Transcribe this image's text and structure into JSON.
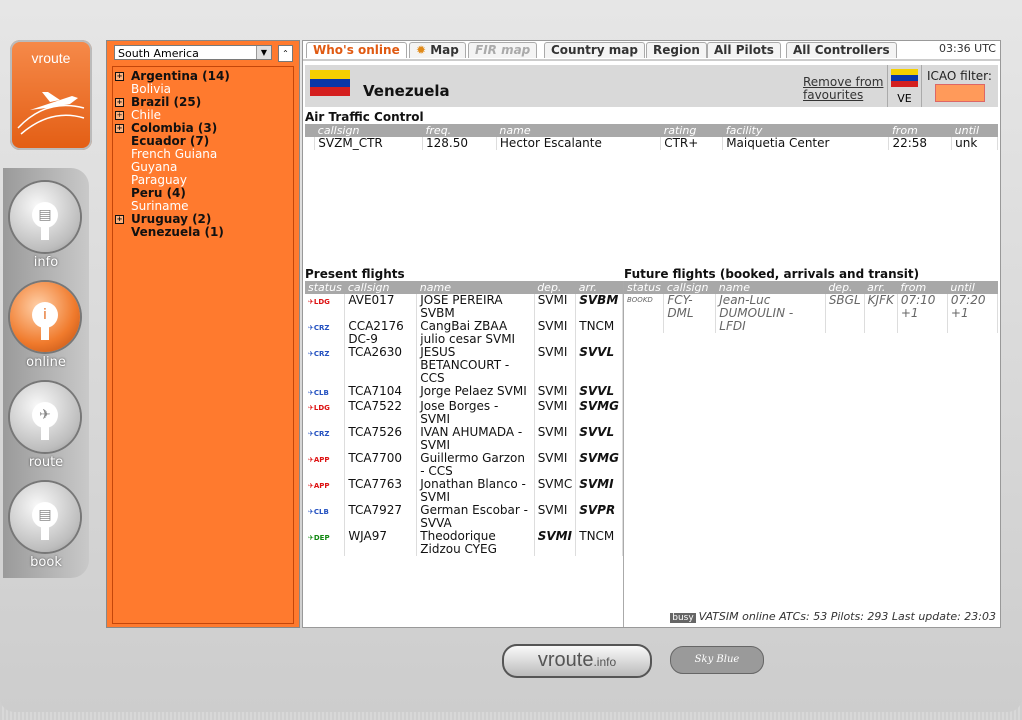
{
  "app": {
    "logo_text": "vroute",
    "bottom_logo": "vroute",
    "bottom_logo_suffix": ".info",
    "partner_logo": "Sky Blue"
  },
  "nav": [
    {
      "label": "info",
      "icon": "document-icon"
    },
    {
      "label": "online",
      "icon": "info-icon",
      "active": true
    },
    {
      "label": "route",
      "icon": "plane-icon"
    },
    {
      "label": "book",
      "icon": "document-icon"
    }
  ],
  "tree": {
    "region": "South America",
    "items": [
      {
        "label": "Argentina (14)",
        "bold": true,
        "expand": true
      },
      {
        "label": "Bolivia",
        "bold": false,
        "expand": false
      },
      {
        "label": "Brazil (25)",
        "bold": true,
        "expand": true
      },
      {
        "label": "Chile",
        "bold": false,
        "expand": true
      },
      {
        "label": "Colombia (3)",
        "bold": true,
        "expand": true
      },
      {
        "label": "Ecuador (7)",
        "bold": true,
        "expand": false
      },
      {
        "label": "French Guiana",
        "bold": false,
        "expand": false
      },
      {
        "label": "Guyana",
        "bold": false,
        "expand": false
      },
      {
        "label": "Paraguay",
        "bold": false,
        "expand": false
      },
      {
        "label": "Peru (4)",
        "bold": true,
        "expand": false
      },
      {
        "label": "Suriname",
        "bold": false,
        "expand": false
      },
      {
        "label": "Uruguay (2)",
        "bold": true,
        "expand": true
      },
      {
        "label": "Venezuela (1)",
        "bold": true,
        "expand": false
      }
    ]
  },
  "tabs": [
    {
      "label": "Who's online",
      "state": "active"
    },
    {
      "label": "Map",
      "state": "normal"
    },
    {
      "label": "FIR map",
      "state": "disabled"
    },
    {
      "label": "Country map",
      "state": "normal"
    },
    {
      "label": "Region",
      "state": "normal"
    },
    {
      "label": "All Pilots",
      "state": "normal"
    },
    {
      "label": "All Controllers",
      "state": "normal"
    }
  ],
  "clock": "03:36 UTC",
  "country": {
    "name": "Venezuela",
    "remove_fav": "Remove from favourites",
    "code": "VE",
    "icao_filter_label": "ICAO filter:",
    "icao_filter_value": ""
  },
  "atc": {
    "title": "Air Traffic Control",
    "headers": [
      "",
      "callsign",
      "freq.",
      "name",
      "rating",
      "facility",
      "from",
      "until"
    ],
    "rows": [
      [
        "",
        "SVZM_CTR",
        "128.50",
        "Hector Escalante",
        "CTR+",
        "Maiquetia Center",
        "22:58",
        "unk"
      ]
    ]
  },
  "present": {
    "title": "Present flights",
    "headers": [
      "status",
      "callsign",
      "name",
      "dep.",
      "arr."
    ],
    "rows": [
      {
        "status": "LDG",
        "callsign": "AVE017",
        "name": "JOSE PEREIRA SVBM",
        "dep": "SVMI",
        "arr": "SVBM",
        "dep_bold": false,
        "arr_bold": true
      },
      {
        "status": "CRZ",
        "callsign": "CCA2176 DC-9",
        "name": "CangBai ZBAA julio cesar SVMI",
        "dep": "SVMI",
        "arr": "TNCM",
        "dep_bold": false,
        "arr_bold": false
      },
      {
        "status": "CRZ",
        "callsign": "TCA2630",
        "name": "JESUS BETANCOURT - CCS",
        "dep": "SVMI",
        "arr": "SVVL",
        "dep_bold": false,
        "arr_bold": true
      },
      {
        "status": "CLB",
        "callsign": "TCA7104",
        "name": "Jorge Pelaez SVMI",
        "dep": "SVMI",
        "arr": "SVVL",
        "dep_bold": false,
        "arr_bold": true
      },
      {
        "status": "LDG",
        "callsign": "TCA7522",
        "name": "Jose Borges - SVMI",
        "dep": "SVMI",
        "arr": "SVMG",
        "dep_bold": false,
        "arr_bold": true
      },
      {
        "status": "CRZ",
        "callsign": "TCA7526",
        "name": "IVAN AHUMADA - SVMI",
        "dep": "SVMI",
        "arr": "SVVL",
        "dep_bold": false,
        "arr_bold": true
      },
      {
        "status": "APP",
        "callsign": "TCA7700",
        "name": "Guillermo Garzon - CCS",
        "dep": "SVMI",
        "arr": "SVMG",
        "dep_bold": false,
        "arr_bold": true
      },
      {
        "status": "APP",
        "callsign": "TCA7763",
        "name": "Jonathan Blanco - SVMI",
        "dep": "SVMC",
        "arr": "SVMI",
        "dep_bold": false,
        "arr_bold": true
      },
      {
        "status": "CLB",
        "callsign": "TCA7927",
        "name": "German Escobar - SVVA",
        "dep": "SVMI",
        "arr": "SVPR",
        "dep_bold": false,
        "arr_bold": true
      },
      {
        "status": "DEP",
        "callsign": "WJA97",
        "name": "Theodorique Zidzou CYEG",
        "dep": "SVMI",
        "arr": "TNCM",
        "dep_bold": true,
        "arr_bold": false
      }
    ]
  },
  "future": {
    "title": "Future flights (booked, arrivals and transit)",
    "headers": [
      "status",
      "callsign",
      "name",
      "dep.",
      "arr.",
      "from",
      "until"
    ],
    "rows": [
      {
        "status": "BOOKD",
        "callsign": "FCY-DML",
        "name": "Jean-Luc DUMOULIN - LFDI",
        "dep": "SBGL",
        "arr": "KJFK",
        "from": "07:10 +1",
        "until": "07:20 +1"
      }
    ]
  },
  "footer": {
    "busy": "busy",
    "text": "VATSIM online ATCs: 53 Pilots: 293 Last update: 23:03"
  }
}
